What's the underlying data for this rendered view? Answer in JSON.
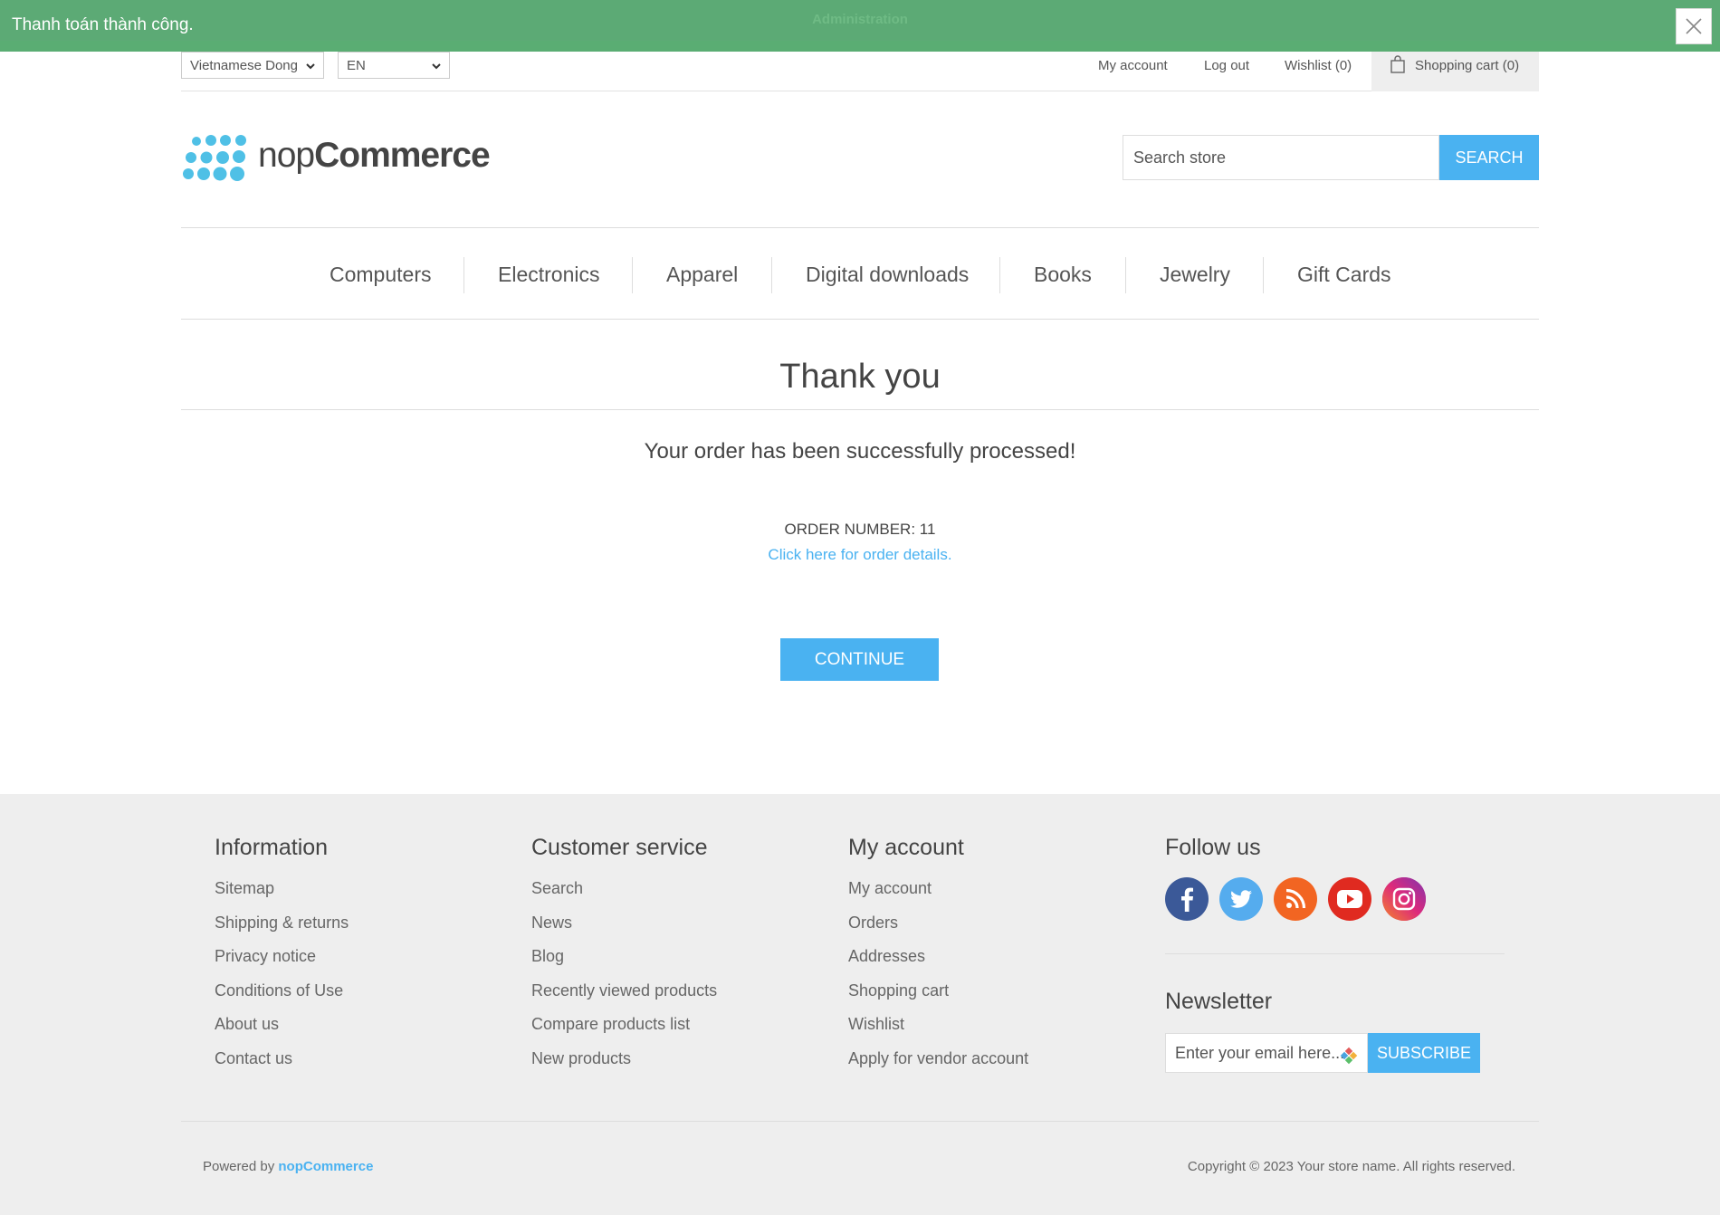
{
  "notification": {
    "message": "Thanh toán thành công.",
    "admin_label": "Administration",
    "close_icon": "close-icon"
  },
  "header": {
    "currency": "Vietnamese Dong",
    "language": "EN",
    "links": {
      "my_account": "My account",
      "log_out": "Log out",
      "wishlist": "Wishlist (0)",
      "shopping_cart": "Shopping cart (0)"
    },
    "logo": {
      "light": "nop",
      "bold": "Commerce"
    },
    "search": {
      "placeholder": "Search store",
      "button": "Search"
    }
  },
  "menu": {
    "items": [
      "Computers",
      "Electronics",
      "Apparel",
      "Digital downloads",
      "Books",
      "Jewelry",
      "Gift Cards"
    ]
  },
  "content": {
    "title": "Thank you",
    "success": "Your order has been successfully processed!",
    "order_number": "ORDER NUMBER: 11",
    "details_link": "Click here for order details.",
    "continue_button": "Continue"
  },
  "footer": {
    "information": {
      "title": "Information",
      "items": [
        "Sitemap",
        "Shipping & returns",
        "Privacy notice",
        "Conditions of Use",
        "About us",
        "Contact us"
      ]
    },
    "customer_service": {
      "title": "Customer service",
      "items": [
        "Search",
        "News",
        "Blog",
        "Recently viewed products",
        "Compare products list",
        "New products"
      ]
    },
    "my_account": {
      "title": "My account",
      "items": [
        "My account",
        "Orders",
        "Addresses",
        "Shopping cart",
        "Wishlist",
        "Apply for vendor account"
      ]
    },
    "follow_us": {
      "title": "Follow us",
      "icons": [
        "facebook-icon",
        "twitter-icon",
        "rss-icon",
        "youtube-icon",
        "instagram-icon"
      ]
    },
    "newsletter": {
      "title": "Newsletter",
      "placeholder": "Enter your email here...",
      "button": "Subscribe"
    },
    "powered_by": "Powered by",
    "powered_brand": "nopCommerce",
    "copyright": "Copyright © 2023 Your store name. All rights reserved."
  },
  "colors": {
    "accent": "#4ab2f1",
    "notification": "#5aad73",
    "footer_bg": "#eeeeee",
    "facebook": "#3b5998",
    "twitter": "#55acee",
    "rss": "#f26522",
    "youtube": "#e02a20",
    "instagram": "#c13584"
  }
}
